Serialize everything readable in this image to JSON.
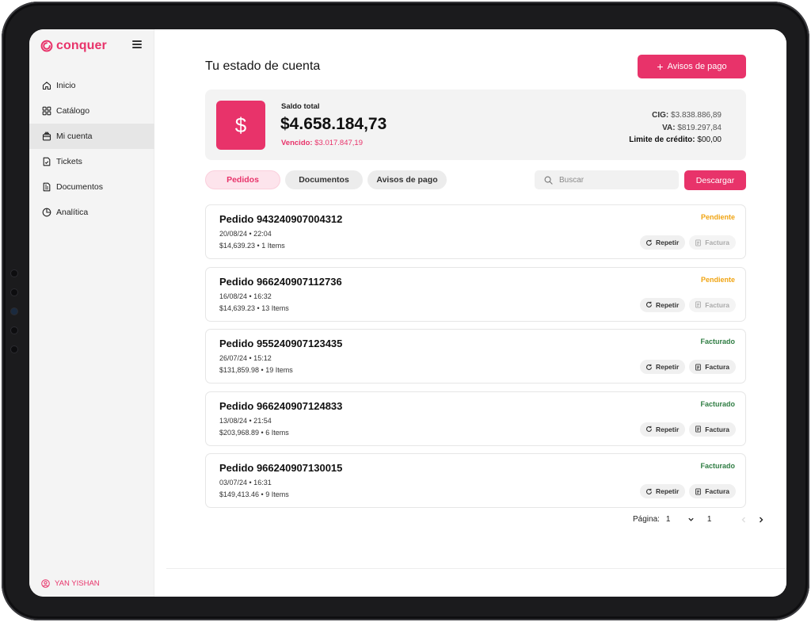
{
  "brand": {
    "name": "conquer",
    "color": "#e8336a"
  },
  "sidebar": {
    "items": [
      {
        "label": "Inicio",
        "icon": "home-icon",
        "active": false
      },
      {
        "label": "Catálogo",
        "icon": "grid-icon",
        "active": false
      },
      {
        "label": "Mi cuenta",
        "icon": "wallet-icon",
        "active": true
      },
      {
        "label": "Tickets",
        "icon": "ticket-icon",
        "active": false
      },
      {
        "label": "Documentos",
        "icon": "document-icon",
        "active": false
      },
      {
        "label": "Analítica",
        "icon": "pie-chart-icon",
        "active": false
      }
    ],
    "user": "YAN YISHAN"
  },
  "header": {
    "title": "Tu estado de cuenta",
    "avisos_button": "Avisos de pago"
  },
  "balance": {
    "label": "Saldo total",
    "value": "$4.658.184,73",
    "vencido_label": "Vencido:",
    "vencido_value": "$3.017.847,19",
    "cig_label": "CIG:",
    "cig_value": "$3.838.886,89",
    "va_label": "VA:",
    "va_value": "$819.297,84",
    "limite_label": "Limite de crédito:",
    "limite_value": "$00,00"
  },
  "tabs": [
    "Pedidos",
    "Documentos",
    "Avisos de pago"
  ],
  "search": {
    "placeholder": "Buscar"
  },
  "download_button": "Descargar",
  "orders": [
    {
      "title": "Pedido 943240907004312",
      "date": "20/08/24 • 22:04",
      "meta": "$14,639.23 • 1 Items",
      "status": "Pendiente",
      "repeat": "Repetir",
      "invoice": "Factura",
      "invoice_enabled": false
    },
    {
      "title": "Pedido 966240907112736",
      "date": "16/08/24 • 16:32",
      "meta": "$14,639.23 • 13 Items",
      "status": "Pendiente",
      "repeat": "Repetir",
      "invoice": "Factura",
      "invoice_enabled": false
    },
    {
      "title": "Pedido 955240907123435",
      "date": "26/07/24 • 15:12",
      "meta": "$131,859.98 • 19 Items",
      "status": "Facturado",
      "repeat": "Repetir",
      "invoice": "Factura",
      "invoice_enabled": true
    },
    {
      "title": "Pedido 966240907124833",
      "date": "13/08/24 • 21:54",
      "meta": "$203,968.89 • 6 Items",
      "status": "Facturado",
      "repeat": "Repetir",
      "invoice": "Factura",
      "invoice_enabled": true
    },
    {
      "title": "Pedido 966240907130015",
      "date": "03/07/24 • 16:31",
      "meta": "$149,413.46 • 9 Items",
      "status": "Facturado",
      "repeat": "Repetir",
      "invoice": "Factura",
      "invoice_enabled": true
    }
  ],
  "pagination": {
    "label": "Página:",
    "selected": "1",
    "total": "1"
  },
  "colors": {
    "pending": "#f0a412",
    "invoiced": "#2f7d43",
    "accent": "#e8336a"
  }
}
